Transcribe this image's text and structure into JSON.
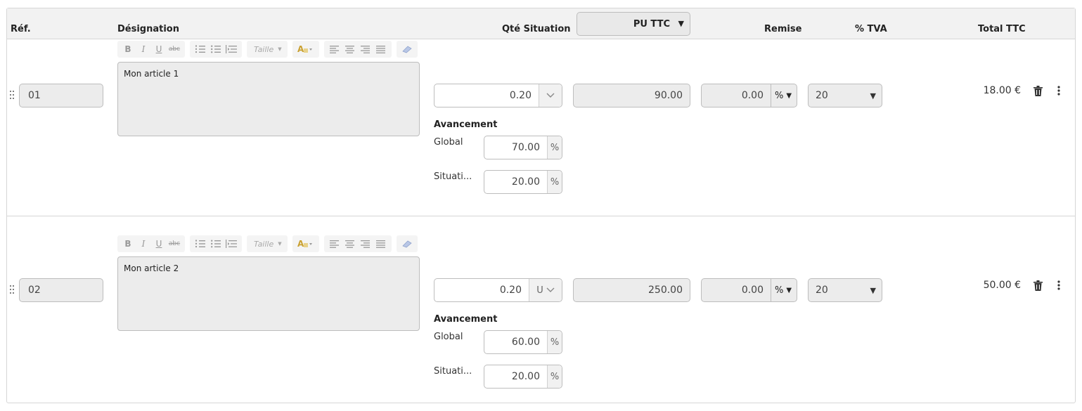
{
  "header": {
    "ref": "Réf.",
    "designation": "Désignation",
    "qty": "Qté Situation",
    "pu_select": "PU TTC",
    "remise": "Remise",
    "tva": "% TVA",
    "total": "Total TTC"
  },
  "toolbar": {
    "bold": "B",
    "italic": "I",
    "underline": "U",
    "strike": "abc",
    "size_placeholder": "Taille"
  },
  "rows": [
    {
      "ref": "01",
      "designation": "Mon article 1",
      "qty": "0.20",
      "unit": "",
      "pu": "90.00",
      "remise": "0.00",
      "remise_unit": "%",
      "tva": "20",
      "total": "18.00 €",
      "avancement_label": "Avancement",
      "global_label": "Global",
      "global_value": "70.00",
      "situation_label": "Situati...",
      "situation_value": "20.00",
      "pct": "%"
    },
    {
      "ref": "02",
      "designation": "Mon article 2",
      "qty": "0.20",
      "unit": "U",
      "pu": "250.00",
      "remise": "0.00",
      "remise_unit": "%",
      "tva": "20",
      "total": "50.00 €",
      "avancement_label": "Avancement",
      "global_label": "Global",
      "global_value": "60.00",
      "situation_label": "Situati...",
      "situation_value": "20.00",
      "pct": "%"
    }
  ]
}
